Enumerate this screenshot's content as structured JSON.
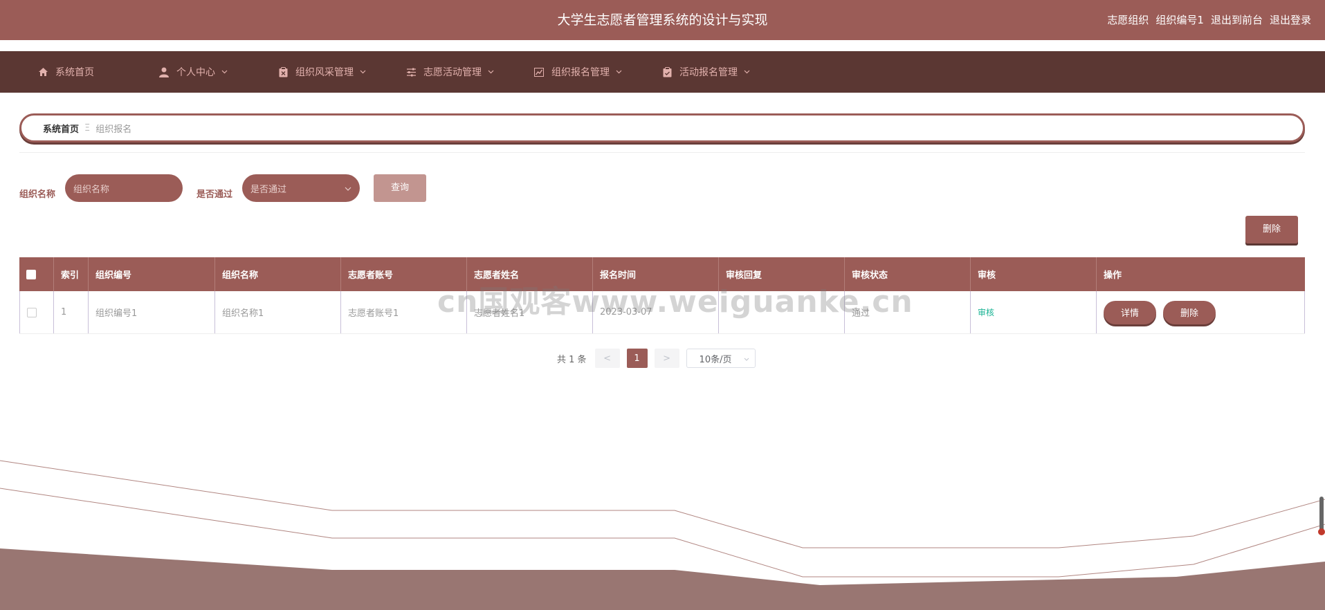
{
  "header": {
    "title": "大学生志愿者管理系统的设计与实现",
    "user_role": "志愿组织",
    "user_name": "组织编号1",
    "to_front": "退出到前台",
    "logout": "退出登录"
  },
  "nav": {
    "items": [
      {
        "label": "系统首页",
        "icon": "home-icon",
        "has_dropdown": false
      },
      {
        "label": "个人中心",
        "icon": "user-icon",
        "has_dropdown": true
      },
      {
        "label": "组织风采管理",
        "icon": "clipboard-x-icon",
        "has_dropdown": true
      },
      {
        "label": "志愿活动管理",
        "icon": "sliders-icon",
        "has_dropdown": true
      },
      {
        "label": "组织报名管理",
        "icon": "chart-icon",
        "has_dropdown": true
      },
      {
        "label": "活动报名管理",
        "icon": "clipboard-check-icon",
        "has_dropdown": true
      }
    ]
  },
  "breadcrumb": {
    "home": "系统首页",
    "separator": "Ξ",
    "current": "组织报名"
  },
  "search": {
    "org_name_label": "组织名称",
    "org_name_placeholder": "组织名称",
    "passed_label": "是否通过",
    "passed_placeholder": "是否通过",
    "query_label": "查询"
  },
  "actions": {
    "delete_label": "删除"
  },
  "table": {
    "columns": [
      "索引",
      "组织编号",
      "组织名称",
      "志愿者账号",
      "志愿者姓名",
      "报名时间",
      "审核回复",
      "审核状态",
      "审核",
      "操作"
    ],
    "rows": [
      {
        "index": "1",
        "org_no": "组织编号1",
        "org_name": "组织名称1",
        "vol_account": "志愿者账号1",
        "vol_name": "志愿者姓名1",
        "signup_time": "2023-03-07",
        "review_reply": "",
        "review_status": "通过",
        "review_link": "审核",
        "detail_label": "详情",
        "delete_label": "删除"
      }
    ]
  },
  "pagination": {
    "total": "共 1 条",
    "prev": "<",
    "current_page": "1",
    "next": ">",
    "page_size": "10条/页"
  },
  "watermark": "cn国观客www.weiguanke.cn",
  "colors": {
    "primary": "#9b5c57",
    "nav_bg": "#5b3733",
    "nav_text": "#e2b1ad",
    "success": "#1ab394"
  }
}
